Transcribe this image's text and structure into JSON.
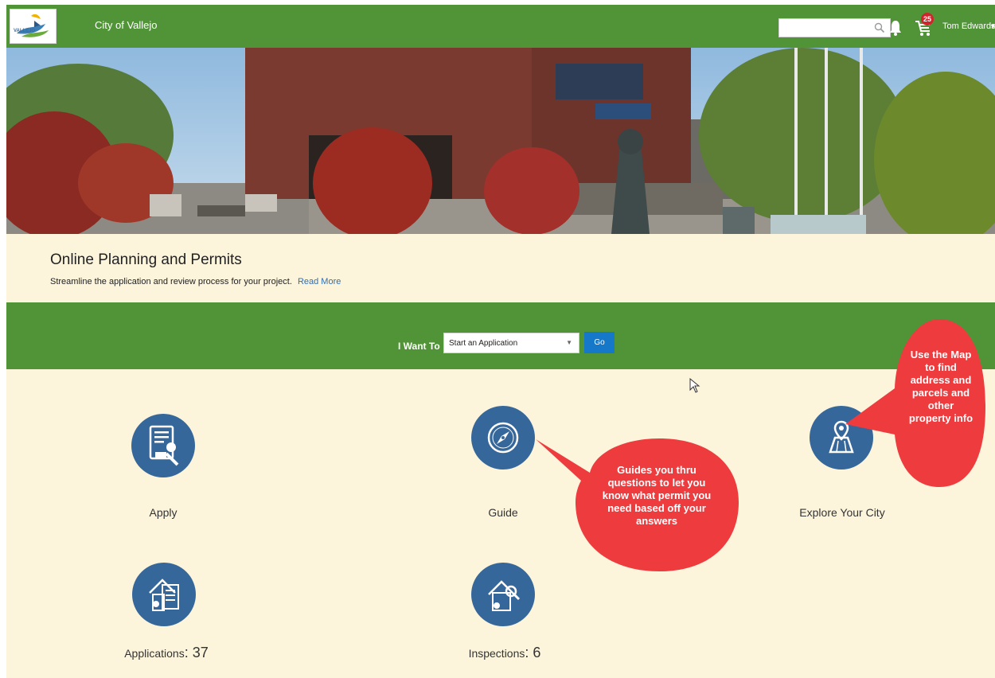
{
  "header": {
    "app_title": "City of Vallejo",
    "logo_text": "VALLEJO",
    "search": {
      "value": "",
      "placeholder": ""
    },
    "cart_count": "25",
    "user_name": "Tom Edwards"
  },
  "intro": {
    "title": "Online Planning and Permits",
    "description": "Streamline the application and review process for your project.",
    "read_more": "Read More"
  },
  "want_to": {
    "label": "I Want To",
    "selected": "Start an Application",
    "go_label": "Go"
  },
  "tiles": {
    "apply": "Apply",
    "guide": "Guide",
    "explore": "Explore Your City",
    "applications": {
      "label": "Applications",
      "count": "37"
    },
    "inspections": {
      "label": "Inspections",
      "count": "6"
    }
  },
  "callouts": {
    "guide": "Guides you thru questions to let you know what permit you need based off your answers",
    "map": "Use the Map to find address and parcels and other property info"
  },
  "colors": {
    "brand_green": "#519438",
    "tile_blue": "#36679b",
    "button_blue": "#1578c9",
    "callout_red": "#ee3b3e",
    "page_bg": "#fcf5dc"
  }
}
